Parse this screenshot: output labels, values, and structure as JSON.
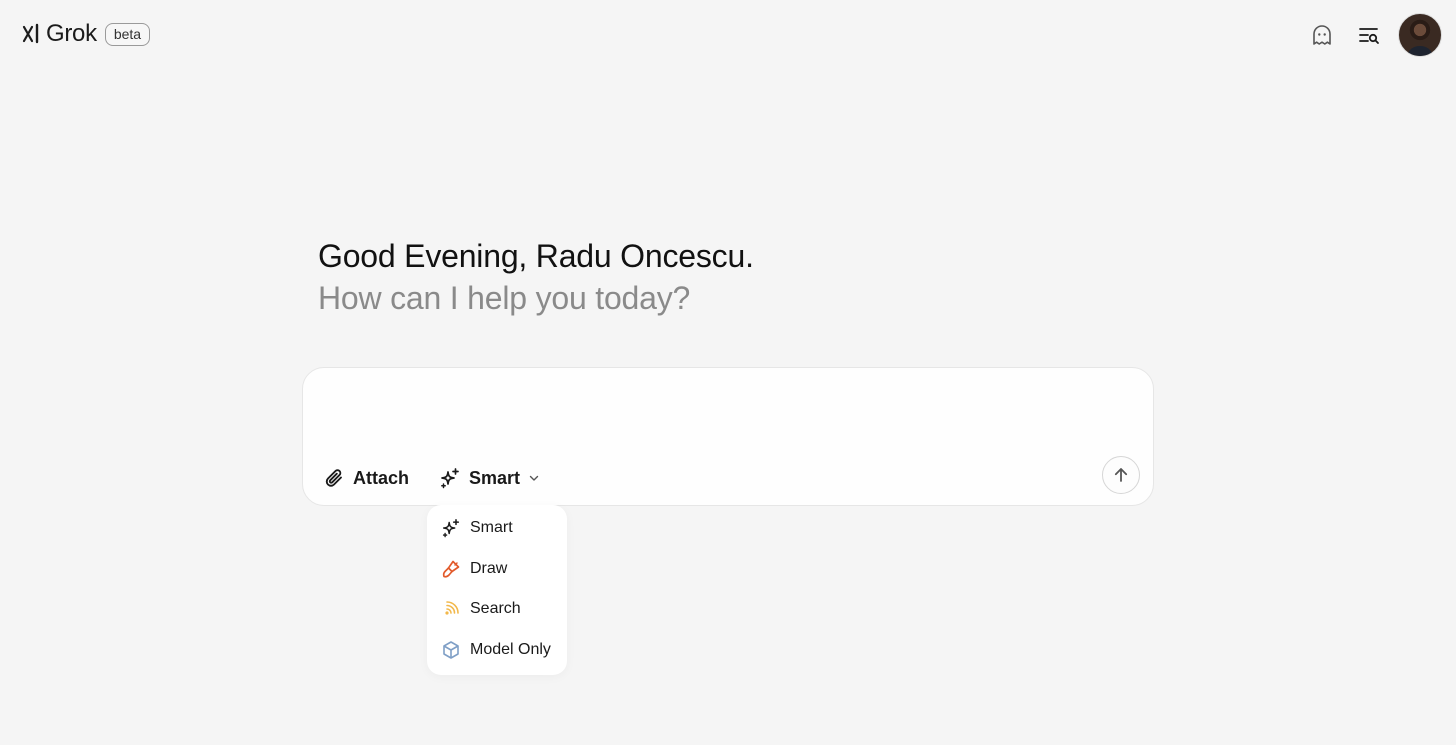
{
  "header": {
    "logo_text": "Grok",
    "badge": "beta",
    "icons": [
      "ghost-icon",
      "search-history-icon",
      "avatar"
    ]
  },
  "greeting": {
    "title": "Good Evening, Radu Oncescu.",
    "subtitle": "How can I help you today?"
  },
  "composer": {
    "placeholder": "",
    "attach_label": "Attach",
    "mode_label": "Smart"
  },
  "mode_menu": {
    "items": [
      {
        "label": "Smart",
        "icon": "sparkle-icon",
        "color": "#1a1a1a"
      },
      {
        "label": "Draw",
        "icon": "paintbrush-icon",
        "color": "#e25a2b"
      },
      {
        "label": "Search",
        "icon": "broadcast-icon",
        "color": "#f2b84b"
      },
      {
        "label": "Model Only",
        "icon": "cube-icon",
        "color": "#7f9fc6"
      }
    ]
  }
}
